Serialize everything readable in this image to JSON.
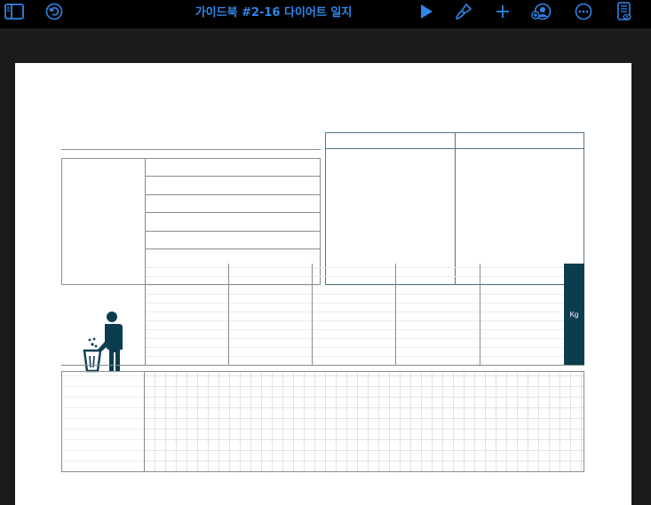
{
  "toolbar": {
    "title": "가이드북 #2-16 다이어트 일지",
    "icons": {
      "sidebar": "sidebar-icon",
      "undo": "undo-icon",
      "play": "play-icon",
      "format": "paintbrush-icon",
      "insert": "plus-icon",
      "collaborate": "collaborate-icon",
      "more": "more-icon",
      "reader": "document-view-icon"
    },
    "accent_color": "#2f86e8"
  },
  "page": {
    "weight_unit": "Kg",
    "weight_bar_color": "#0c3d4f",
    "trash_icon": "person-trash-icon"
  }
}
